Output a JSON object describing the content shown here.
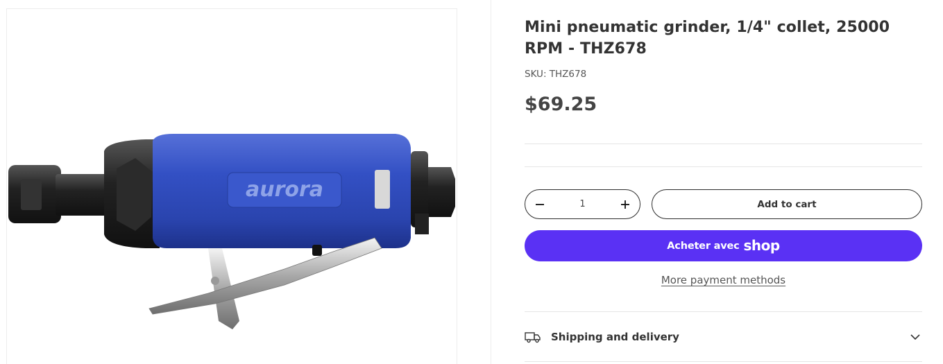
{
  "product": {
    "title": "Mini pneumatic grinder, 1/4\" collet, 25000 RPM - THZ678",
    "sku": "SKU: THZ678",
    "price": "$69.25",
    "image_brand_text": "aurora",
    "image_alt": "Blue pneumatic die grinder"
  },
  "quantity": {
    "value": "1",
    "decrease_icon": "minus-icon",
    "increase_icon": "plus-icon"
  },
  "buttons": {
    "add_to_cart": "Add to cart",
    "shop_pay_prefix": "Acheter avec",
    "shop_pay_brand": "shop",
    "more_payment": "More payment methods"
  },
  "accordion": {
    "shipping_label": "Shipping and delivery",
    "icon": "truck-icon",
    "toggle_icon": "chevron-down-icon"
  },
  "colors": {
    "shop_pay": "#5a31f4",
    "text": "#333333",
    "tool_blue": "#2f4fb8"
  }
}
